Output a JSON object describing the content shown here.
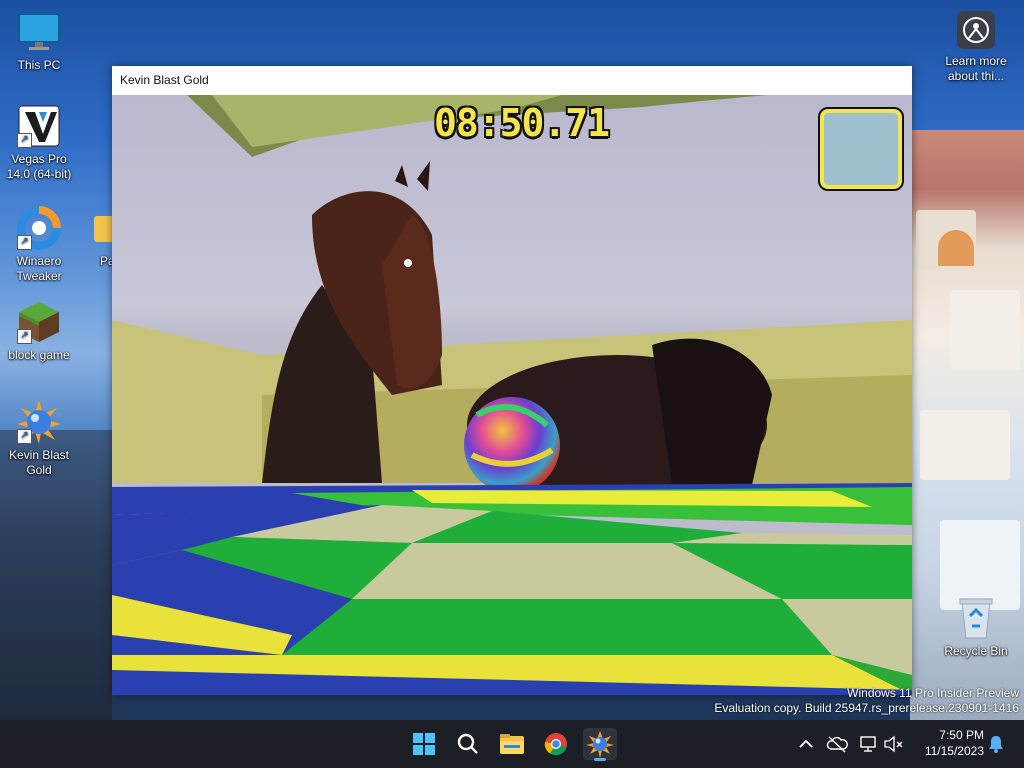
{
  "desktop": {
    "icons": [
      {
        "label": "This PC",
        "icon": "monitor-icon"
      },
      {
        "label": "Vegas Pro 14.0 (64-bit)",
        "icon": "vegas-pro-icon"
      },
      {
        "label": "Winaero Tweaker",
        "icon": "winaero-icon"
      },
      {
        "label": "block game",
        "icon": "grass-block-icon"
      },
      {
        "label": "Kevin Blast Gold",
        "icon": "kevin-blast-icon"
      },
      {
        "label": "Learn more about thi...",
        "icon": "learn-more-icon"
      },
      {
        "label": "Recycle Bin",
        "icon": "recycle-bin-icon"
      },
      {
        "label": "Pa",
        "icon": "folder-icon"
      }
    ],
    "watermark": {
      "line1": "Windows 11 Pro Insider Preview",
      "line2": "Evaluation copy. Build 25947.rs_prerelease.230901-1416"
    }
  },
  "window": {
    "title": "Kevin Blast Gold",
    "hud": {
      "timer": "08:50.71"
    }
  },
  "taskbar": {
    "apps": [
      "start-icon",
      "search-icon",
      "file-explorer-icon",
      "chrome-icon",
      "kevin-blast-icon"
    ],
    "clock": {
      "time": "7:50 PM",
      "date": "11/15/2023"
    }
  },
  "colors": {
    "hud_yellow": "#f4e64a",
    "taskbar": "#1c1f26",
    "accent": "#5ab0f5"
  }
}
